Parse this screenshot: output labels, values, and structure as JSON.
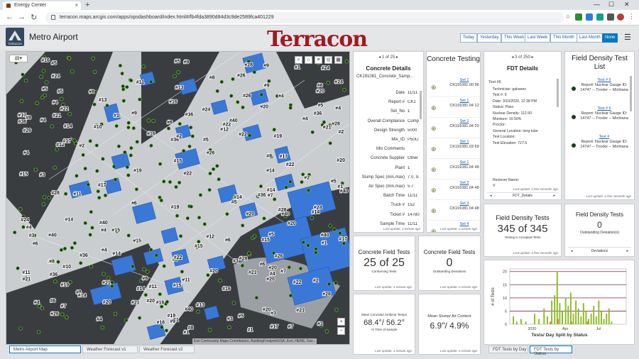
{
  "browser": {
    "tab_title": "Energy Center",
    "tab_close": "×",
    "new_tab": "+",
    "window_controls": [
      "—",
      "☐",
      "✕"
    ],
    "url": "terracon.maps.arcgis.com/apps/opsdashboard/index.html#/fb4fda3890d84d3c9de2589fca401229"
  },
  "header": {
    "logo_text": "TERRACON",
    "title": "Metro Airport",
    "brand": "Terracon",
    "date_buttons": [
      "Today",
      "Yesterday",
      "This Week",
      "Last Week",
      "This Month",
      "Last Month",
      "None"
    ],
    "active_date": "None",
    "menu_glyph": "☰"
  },
  "map": {
    "attribution": "Esri Community Maps Contributors, BuildingFootprintUSA, Esri, HERE, Gar...",
    "zoom_in": "+",
    "zoom_out": "−",
    "labels": [
      "#1",
      "#2",
      "#3",
      "#4",
      "#5",
      "#6",
      "#7",
      "#8",
      "#9",
      "#10",
      "#11",
      "#12",
      "#13",
      "#14",
      "#15",
      "#16",
      "#17",
      "#19",
      "#20",
      "#21",
      "#22",
      "#24",
      "#26",
      "#28",
      "#36",
      "#40"
    ],
    "colors": {
      "building": "#3a78d8",
      "runway": "#3a3d40",
      "ground": "#c9cdd0",
      "point": "#1e3a1e",
      "point_ring": "#6fcf3f"
    }
  },
  "concrete_details": {
    "pager": "1 of 25",
    "title": "Concrete Details",
    "record_id": "CK191081_Concrete_Samp...",
    "rows": [
      {
        "label": "Date",
        "value": "11/11"
      },
      {
        "label": "Report #",
        "value": "CK1"
      },
      {
        "label": "Set_No",
        "value": "1"
      },
      {
        "label": "Overall Compliance",
        "value": "Comp"
      },
      {
        "label": "Design Strength",
        "value": "5000"
      },
      {
        "label": "Mix_ID",
        "value": "P50LI"
      },
      {
        "label": "Mix Comments",
        "value": ""
      },
      {
        "label": "Concrete Supplier",
        "value": "Other"
      },
      {
        "label": "Plant",
        "value": "1"
      },
      {
        "label": "Slump Spec (min,max)",
        "value": "7.0, 9."
      },
      {
        "label": "Air Spec (min,max)",
        "value": "5.7"
      },
      {
        "label": "Batch Time",
        "value": "11/11"
      },
      {
        "label": "Truck #",
        "value": "152"
      },
      {
        "label": "Ticket #",
        "value": "14780"
      },
      {
        "label": "Sample Time",
        "value": "11/11"
      }
    ],
    "last_update": "Last update: a minute ago"
  },
  "concrete_testing": {
    "title": "Concrete Testing",
    "sets": [
      {
        "label": "Set 1",
        "value": "CK191081.00 96"
      },
      {
        "label": "Set 1",
        "value": "CK191081.04 12"
      },
      {
        "label": "Set 1",
        "value": "CK191081.04 20"
      },
      {
        "label": "Set 1",
        "value": "CK191081.03 69"
      },
      {
        "label": "Set 1",
        "value": "CK191081.04 48"
      },
      {
        "label": "Set 2",
        "value": "CK191081.04 48"
      },
      {
        "label": "Set 3",
        "value": "CK191081.04 48"
      },
      {
        "label": "Set 4",
        "value": ""
      }
    ],
    "last_update": "Last update: a minute ago"
  },
  "fdt_details": {
    "pager": "3 of 250",
    "title": "FDT Details",
    "test_name": "Test #6",
    "fields": [
      "Technician: galvarez",
      "Test #: 6",
      "Date: 3/10/2020, 12:38 PM",
      "Status: Pass",
      "Nuclear Density: 112.50",
      "Moisture: 10.50%",
      "Proctor:",
      "General Location: long tube",
      "Test Location:",
      "Test Elevation: 727.5"
    ],
    "receiver_label": "Reciever Name:",
    "receiver_value": "V",
    "last_update": "Last update: a few seconds ago",
    "footer_label": "FDT_Details"
  },
  "fdt_list": {
    "title": "Field Density Test List",
    "items": [
      {
        "name": "Test # 6",
        "lines": "Report: Nuclear Gauge ID: 14747 -- Troxler -- Michiana"
      },
      {
        "name": "Test # 6",
        "lines": "Report: Nuclear Gauge ID: 14747 -- Troxler -- Michiana"
      },
      {
        "name": "Test #",
        "lines": "Report: Nuclear Gauge ID: 14747 -- Troxler -- Michiana"
      }
    ],
    "last_update": "Last update: a few seconds ago"
  },
  "concrete_field_tests": {
    "title": "Concrete Field Tests",
    "value": "25 of 25",
    "subtitle": "Conforming Tests",
    "last_update": "Last update: a minute ago"
  },
  "concrete_deviations": {
    "title": "Concrete Field Tests",
    "value": "0",
    "subtitle": "Outstanding Deviations",
    "last_update": "Last update: a minute ago"
  },
  "field_density_tests": {
    "title": "Field Density Tests",
    "value": "345 of 345",
    "subtitle": "Testing in Accepted Tests",
    "last_update": "Last update: a few seconds ago"
  },
  "fdt_deviations": {
    "title": "Field Density Tests",
    "value": "0",
    "subtitle": "Outstanding Deviation(s)",
    "footer_label": "Deviations"
  },
  "ambient_temps": {
    "title": "Mean Concrete/ Ambient Temps",
    "value": "68.4°/ 56.2°",
    "subtitle": "At Time of Sample",
    "last_update": "Last update: a minute ago"
  },
  "slump_air": {
    "title": "Mean Slump/ Air Content",
    "value": "6.9\"/ 4.9%",
    "last_update": "Last update: a minute ago"
  },
  "chart_data": {
    "type": "bar",
    "title": "Tests/ Day Split by Status",
    "ylabel": "# of Tests",
    "yticks": [
      0,
      5,
      10,
      15,
      20
    ],
    "ylim": [
      0,
      21
    ],
    "xticks": [
      "2020",
      "Apr",
      "Jul"
    ],
    "xlim": [
      "2019-11-01",
      "2020-09-15"
    ],
    "series": [
      {
        "color": "#8fbc2a",
        "x": [
          "2019-11-11",
          "2019-11-20",
          "2019-12-02",
          "2019-12-15",
          "2020-01-08",
          "2020-01-20",
          "2020-02-03",
          "2020-02-12",
          "2020-02-24",
          "2020-03-03",
          "2020-03-10",
          "2020-03-17",
          "2020-03-24",
          "2020-04-02",
          "2020-04-09",
          "2020-04-16",
          "2020-04-23",
          "2020-04-30",
          "2020-05-07",
          "2020-05-14",
          "2020-05-21",
          "2020-05-28",
          "2020-06-04",
          "2020-06-11",
          "2020-06-18",
          "2020-06-25",
          "2020-07-02",
          "2020-07-09",
          "2020-07-16",
          "2020-07-23",
          "2020-07-30",
          "2020-08-06"
        ],
        "values": [
          3,
          1,
          2,
          1,
          4,
          2,
          6,
          3,
          9,
          11,
          20,
          8,
          5,
          10,
          7,
          12,
          4,
          9,
          6,
          3,
          8,
          5,
          2,
          4,
          7,
          3,
          9,
          5,
          2,
          4,
          6,
          1
        ]
      },
      {
        "color": "#d9822b",
        "x": [
          "2020-02-20",
          "2020-03-12",
          "2020-04-18",
          "2020-06-01"
        ],
        "values": [
          1,
          2,
          1,
          1
        ]
      }
    ],
    "reference_lines": [
      {
        "y": 20,
        "color": "#8b2252"
      },
      {
        "y": 15,
        "color": "#8b2252"
      },
      {
        "y": 10,
        "color": "#8b2252"
      },
      {
        "y": 5,
        "color": "#8b2252"
      }
    ]
  },
  "bottom_tabs": {
    "map": [
      "Metro Airport Map",
      "Weather Forecast v1",
      "Weather Forecast v2"
    ],
    "chart": [
      "FDT Tests by Day",
      "FDT Tests by Status"
    ]
  }
}
